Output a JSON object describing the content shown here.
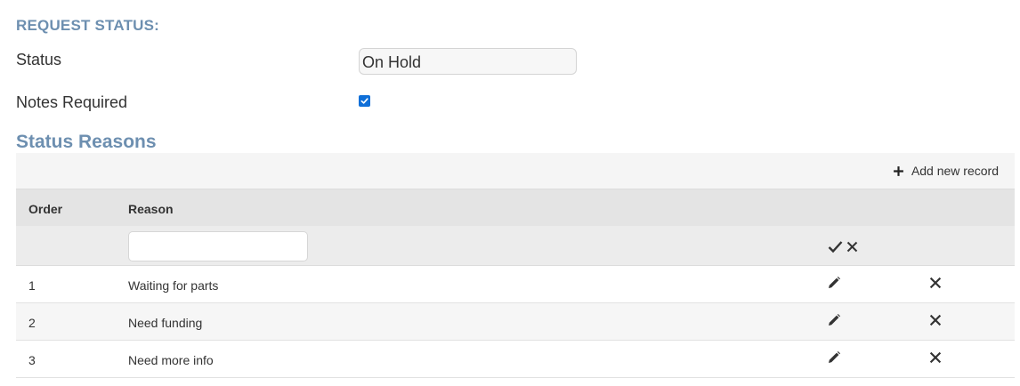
{
  "request_status": {
    "section_title": "REQUEST STATUS:",
    "status_label": "Status",
    "status_value": "On Hold",
    "notes_required_label": "Notes Required",
    "notes_required_checked": true
  },
  "status_reasons": {
    "title": "Status Reasons",
    "toolbar": {
      "add_label": "Add new record",
      "add_icon": "plus-icon"
    },
    "columns": {
      "order": "Order",
      "reason": "Reason"
    },
    "filter": {
      "reason_value": "",
      "confirm_icon": "check-icon",
      "cancel_icon": "close-icon"
    },
    "rows": [
      {
        "order": "1",
        "reason": "Waiting for parts"
      },
      {
        "order": "2",
        "reason": "Need funding"
      },
      {
        "order": "3",
        "reason": "Need more info"
      }
    ],
    "row_icons": {
      "edit": "pencil-icon",
      "delete": "close-icon"
    }
  },
  "colors": {
    "heading": "#6d8fb0",
    "checkbox": "#0f6fd8",
    "toolbar_bg": "#f5f5f5",
    "header_bg": "#e4e4e4",
    "alt_row_bg": "#f6f6f6"
  }
}
